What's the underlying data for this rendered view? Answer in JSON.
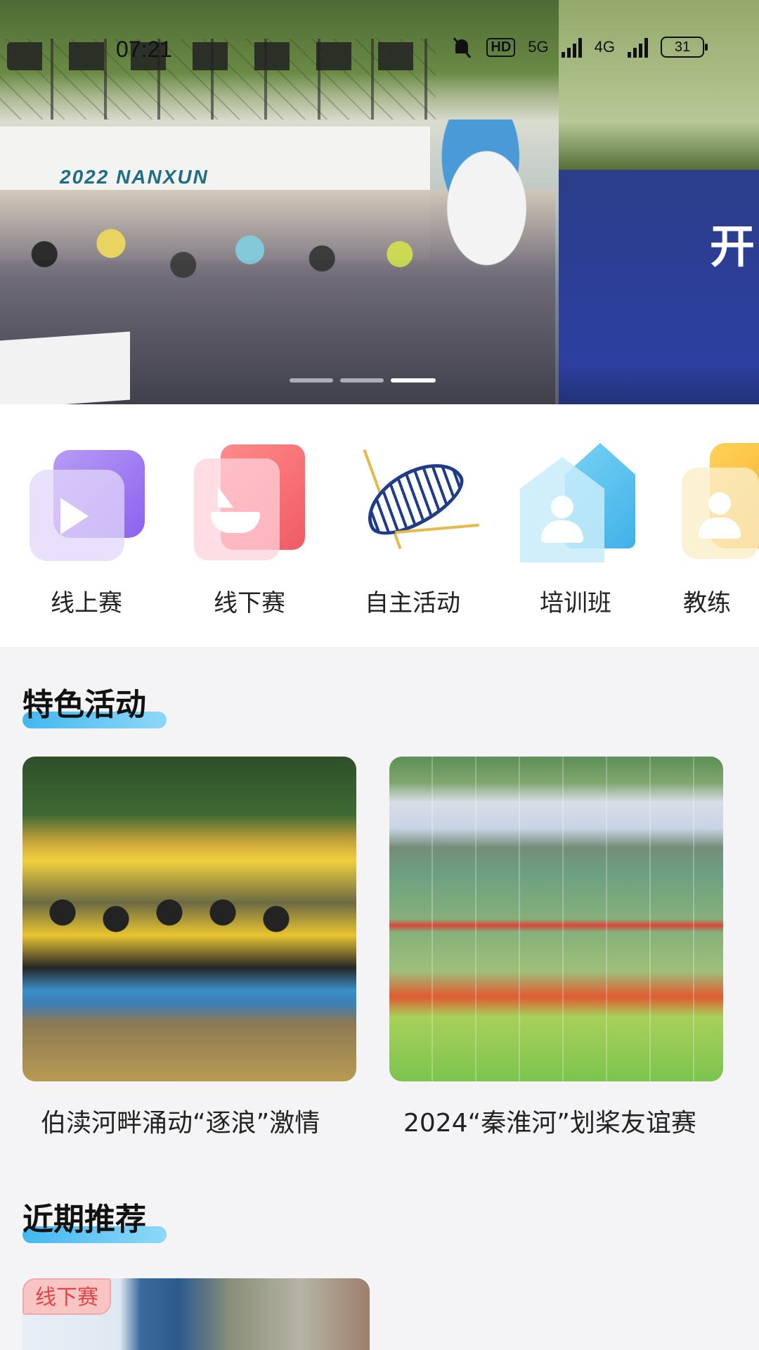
{
  "status_bar": {
    "time": "07:21",
    "hd_label": "HD",
    "network_1": "5G",
    "network_2": "4G",
    "battery": "31"
  },
  "banner": {
    "board_title": "2022 NANXUN",
    "next_slide_text": "开",
    "active_dot": 2,
    "dot_count": 3
  },
  "categories": [
    {
      "label": "线上赛",
      "icon": "video-play-icon"
    },
    {
      "label": "线下赛",
      "icon": "boat-card-icon"
    },
    {
      "label": "自主活动",
      "icon": "rowing-boat-icon"
    },
    {
      "label": "培训班",
      "icon": "person-house-icon"
    },
    {
      "label": "教练",
      "icon": "coach-person-icon"
    }
  ],
  "featured": {
    "title": "特色活动",
    "cards": [
      {
        "title": "伯渎河畔涌动“逐浪”激情"
      },
      {
        "title": "2024“秦淮河”划桨友谊赛"
      }
    ]
  },
  "recommended": {
    "title": "近期推荐",
    "cards": [
      {
        "badge": "线下赛"
      }
    ]
  },
  "colors": {
    "accent_gradient_start": "#43b7f0",
    "accent_gradient_end": "#8ed8f8",
    "badge_bg": "#f9c4c4",
    "badge_text": "#e04545",
    "page_bg": "#f4f4f6"
  }
}
